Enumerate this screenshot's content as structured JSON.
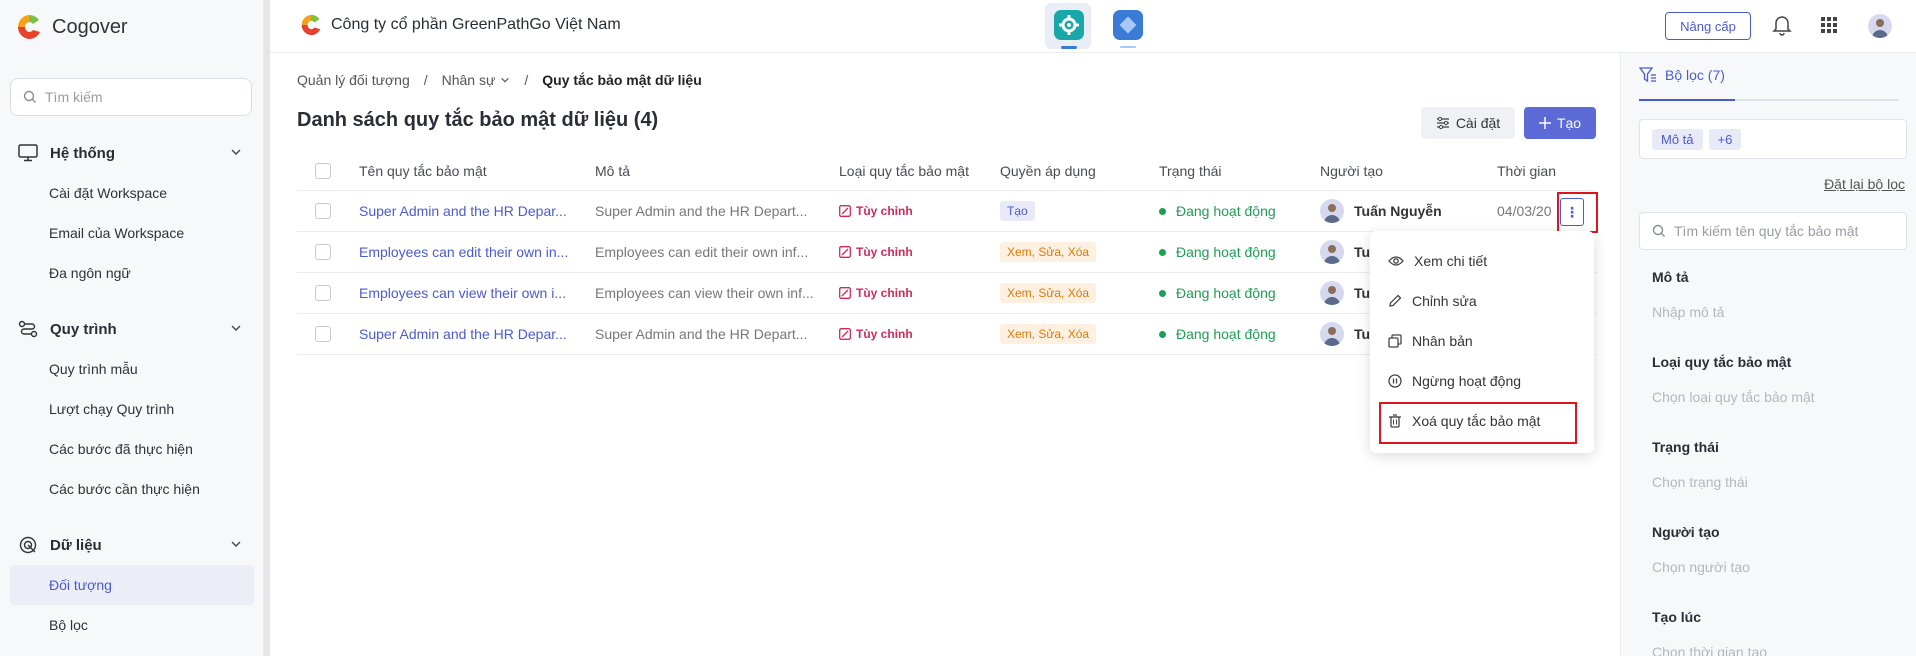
{
  "app": {
    "name": "Cogover"
  },
  "sidebar": {
    "search_placeholder": "Tìm kiếm",
    "sections": [
      {
        "title": "Hệ thống",
        "items": [
          "Cài đặt Workspace",
          "Email của Workspace",
          "Đa ngôn ngữ"
        ]
      },
      {
        "title": "Quy trình",
        "items": [
          "Quy trình mẫu",
          "Lượt chạy Quy trình",
          "Các bước đã thực hiện",
          "Các bước cần thực hiện"
        ]
      },
      {
        "title": "Dữ liệu",
        "items": [
          "Đối tượng",
          "Bộ lọc"
        ]
      }
    ]
  },
  "topbar": {
    "company": "Công ty cổ phần GreenPathGo Việt Nam",
    "upgrade_label": "Nâng cấp"
  },
  "breadcrumb": {
    "root": "Quản lý đối tượng",
    "mid": "Nhân sự",
    "current": "Quy tắc bảo mật dữ liệu"
  },
  "page": {
    "title": "Danh sách quy tắc bảo mật dữ liệu (4)",
    "settings_label": "Cài đặt",
    "create_label": "Tạo"
  },
  "table": {
    "headers": [
      "Tên quy tắc bảo mật",
      "Mô tả",
      "Loại quy tắc bảo mật",
      "Quyền áp dụng",
      "Trạng thái",
      "Người tạo",
      "Thời gian"
    ],
    "rows": [
      {
        "name": "Super Admin and the HR Depar...",
        "desc": "Super Admin and the HR Depart...",
        "type": "Tùy chỉnh",
        "perm": "Tạo",
        "status": "Đang hoạt động",
        "creator": "Tuấn Nguyễn",
        "time": "04/03/20"
      },
      {
        "name": "Employees can edit their own in...",
        "desc": "Employees can edit their own inf...",
        "type": "Tùy chỉnh",
        "perm": "Xem, Sửa, Xóa",
        "status": "Đang hoạt động",
        "creator": "Tu",
        "time": ""
      },
      {
        "name": "Employees can view their own i...",
        "desc": "Employees can view their own inf...",
        "type": "Tùy chỉnh",
        "perm": "Xem, Sửa, Xóa",
        "status": "Đang hoạt động",
        "creator": "Tu",
        "time": ""
      },
      {
        "name": "Super Admin and the HR Depar...",
        "desc": "Super Admin and the HR Depart...",
        "type": "Tùy chỉnh",
        "perm": "Xem, Sửa, Xóa",
        "status": "Đang hoạt động",
        "creator": "Tu",
        "time": ""
      }
    ]
  },
  "menu": {
    "items": [
      "Xem chi tiết",
      "Chỉnh sửa",
      "Nhân bản",
      "Ngừng hoạt động",
      "Xoá quy tắc bảo mật"
    ]
  },
  "filter": {
    "tab_label": "Bộ lọc (7)",
    "chip_1": "Mô tả",
    "chip_more": "+6",
    "reset_label": "Đặt lại bộ lọc",
    "search_placeholder": "Tìm kiếm tên quy tắc bảo mật",
    "fields": [
      {
        "label": "Mô tả",
        "placeholder": "Nhập mô tả"
      },
      {
        "label": "Loại quy tắc bảo mật",
        "placeholder": "Chọn loại quy tắc bảo mật"
      },
      {
        "label": "Trạng thái",
        "placeholder": "Chọn trạng thái"
      },
      {
        "label": "Người tạo",
        "placeholder": "Chọn người tạo"
      },
      {
        "label": "Tạo lúc",
        "placeholder": "Chọn thời gian tạo"
      }
    ]
  },
  "colors": {
    "accent": "#4a5bd1",
    "success": "#1f9d55",
    "danger": "#d12a5a",
    "highlight": "#e0141e"
  }
}
